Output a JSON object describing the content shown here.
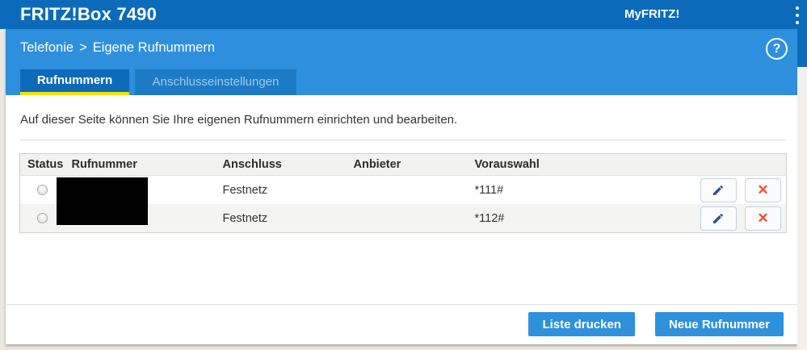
{
  "colors": {
    "header_bg": "#0b6bba",
    "band_bg": "#2e90dd",
    "tab_inactive_bg": "#1d7ac5",
    "tab_inactive_text": "#a5c9e9",
    "tab_underline": "#f6e400",
    "accent": "#2e91dc",
    "edit_icon": "#2f5291",
    "delete_icon": "#ee4f33",
    "page_bg": "#ebe8e2"
  },
  "header": {
    "title": "FRITZ!Box 7490",
    "myfritz_label": "MyFRITZ!"
  },
  "breadcrumb": {
    "section": "Telefonie",
    "separator": ">",
    "page": "Eigene Rufnummern"
  },
  "help": {
    "glyph": "?"
  },
  "tabs": [
    {
      "label": "Rufnummern",
      "active": true
    },
    {
      "label": "Anschlusseinstellungen",
      "active": false
    }
  ],
  "intro": "Auf dieser Seite können Sie Ihre eigenen Rufnummern einrichten und bearbeiten.",
  "table": {
    "columns": [
      "Status",
      "Rufnummer",
      "Anschluss",
      "Anbieter",
      "Vorauswahl"
    ],
    "rows": [
      {
        "status": "radio-unselected",
        "rufnummer": "",
        "redacted": true,
        "anschluss": "Festnetz",
        "anbieter": "",
        "vorauswahl": "*111#"
      },
      {
        "status": "radio-unselected",
        "rufnummer": "",
        "redacted": true,
        "anschluss": "Festnetz",
        "anbieter": "",
        "vorauswahl": "*112#"
      }
    ],
    "delete_glyph": "✕"
  },
  "footer": {
    "print_label": "Liste drucken",
    "new_number_label": "Neue Rufnummer"
  }
}
